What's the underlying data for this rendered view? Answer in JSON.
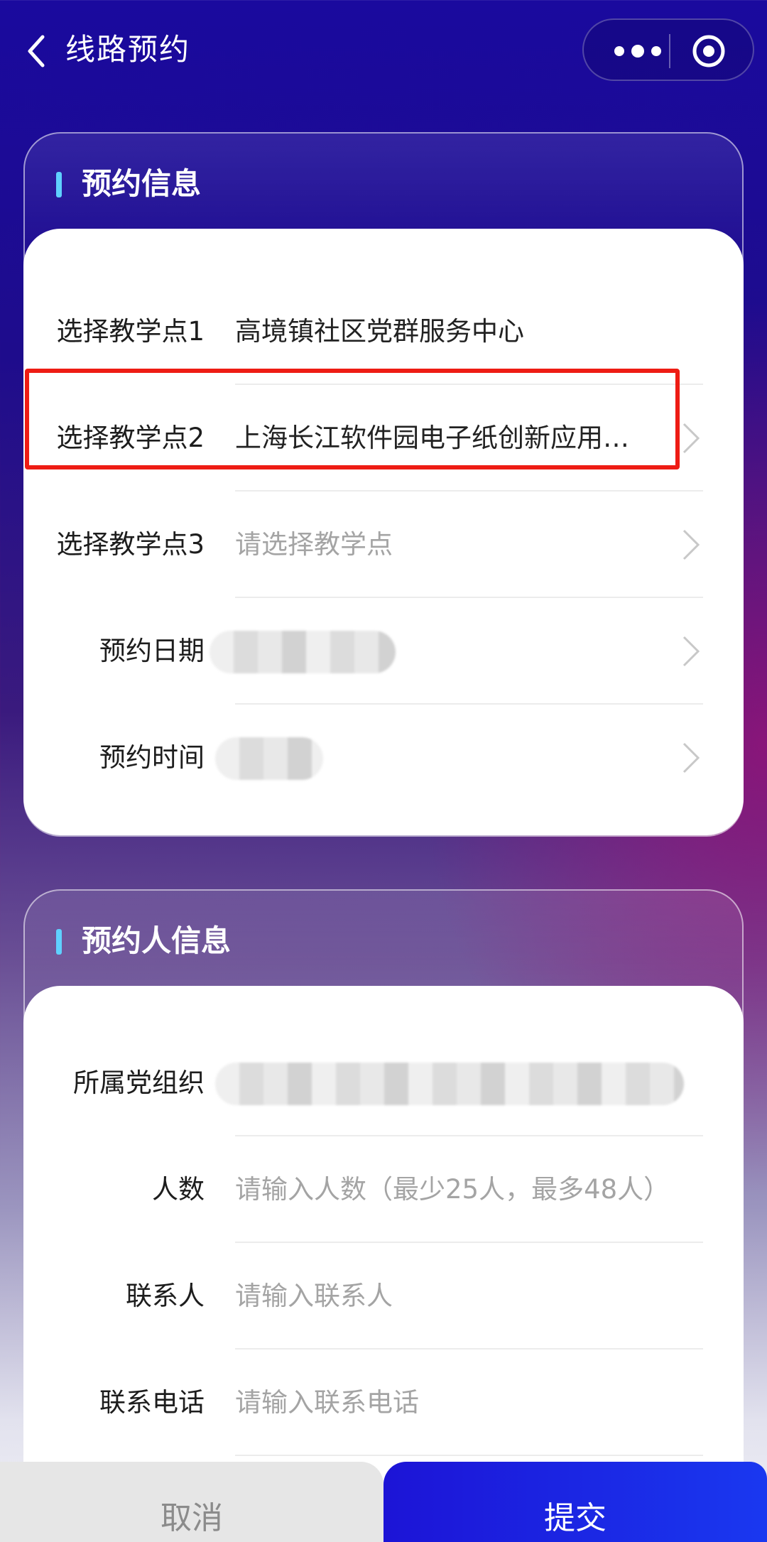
{
  "header": {
    "title": "线路预约",
    "back_icon": "chevron-left-icon",
    "more_icon": "more-dots-icon",
    "close_icon": "target-circle-icon"
  },
  "booking_section": {
    "title": "预约信息",
    "rows": [
      {
        "label": "选择教学点1",
        "value": "高境镇社区党群服务中心"
      },
      {
        "label": "选择教学点2",
        "value": "上海长江软件园电子纸创新应用…"
      },
      {
        "label": "选择教学点3",
        "placeholder": "请选择教学点"
      },
      {
        "label": "预约日期",
        "value_blurred": true
      },
      {
        "label": "预约时间",
        "value_blurred": true
      }
    ]
  },
  "applicant_section": {
    "title": "预约人信息",
    "rows": [
      {
        "label": "所属党组织",
        "value_blurred": true
      },
      {
        "label": "人数",
        "placeholder": "请输入人数（最少25人，最多48人）"
      },
      {
        "label": "联系人",
        "placeholder": "请输入联系人"
      },
      {
        "label": "联系电话",
        "placeholder": "请输入联系电话"
      }
    ]
  },
  "footer": {
    "cancel_label": "取消",
    "submit_label": "提交"
  },
  "colors": {
    "accent_bar": "#5fd0ff",
    "submit_button": "#1c14d6",
    "highlight_box": "#ee1c14"
  }
}
